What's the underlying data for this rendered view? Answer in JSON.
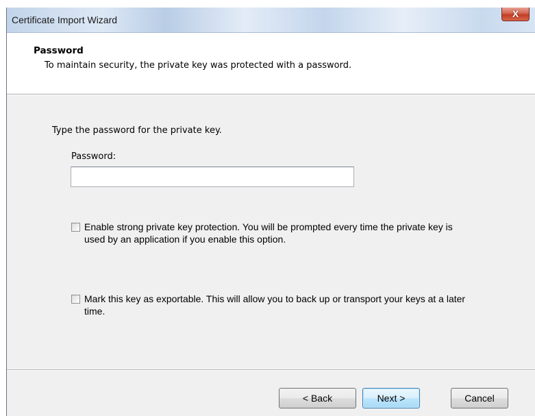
{
  "window": {
    "title": "Certificate Import Wizard",
    "close_glyph": "X"
  },
  "header": {
    "title": "Password",
    "subtitle": "To maintain security, the private key was protected with a password."
  },
  "content": {
    "instruction": "Type the password for the private key.",
    "password_label": "Password:",
    "password_value": "",
    "options": [
      {
        "label": "Enable strong private key protection. You will be prompted every time the private key is used by an application if you enable this option.",
        "checked": false
      },
      {
        "label": "Mark this key as exportable. This will allow you to back up or transport your keys at a later time.",
        "checked": false
      }
    ]
  },
  "buttons": {
    "back": "< Back",
    "next": "Next >",
    "cancel": "Cancel"
  }
}
